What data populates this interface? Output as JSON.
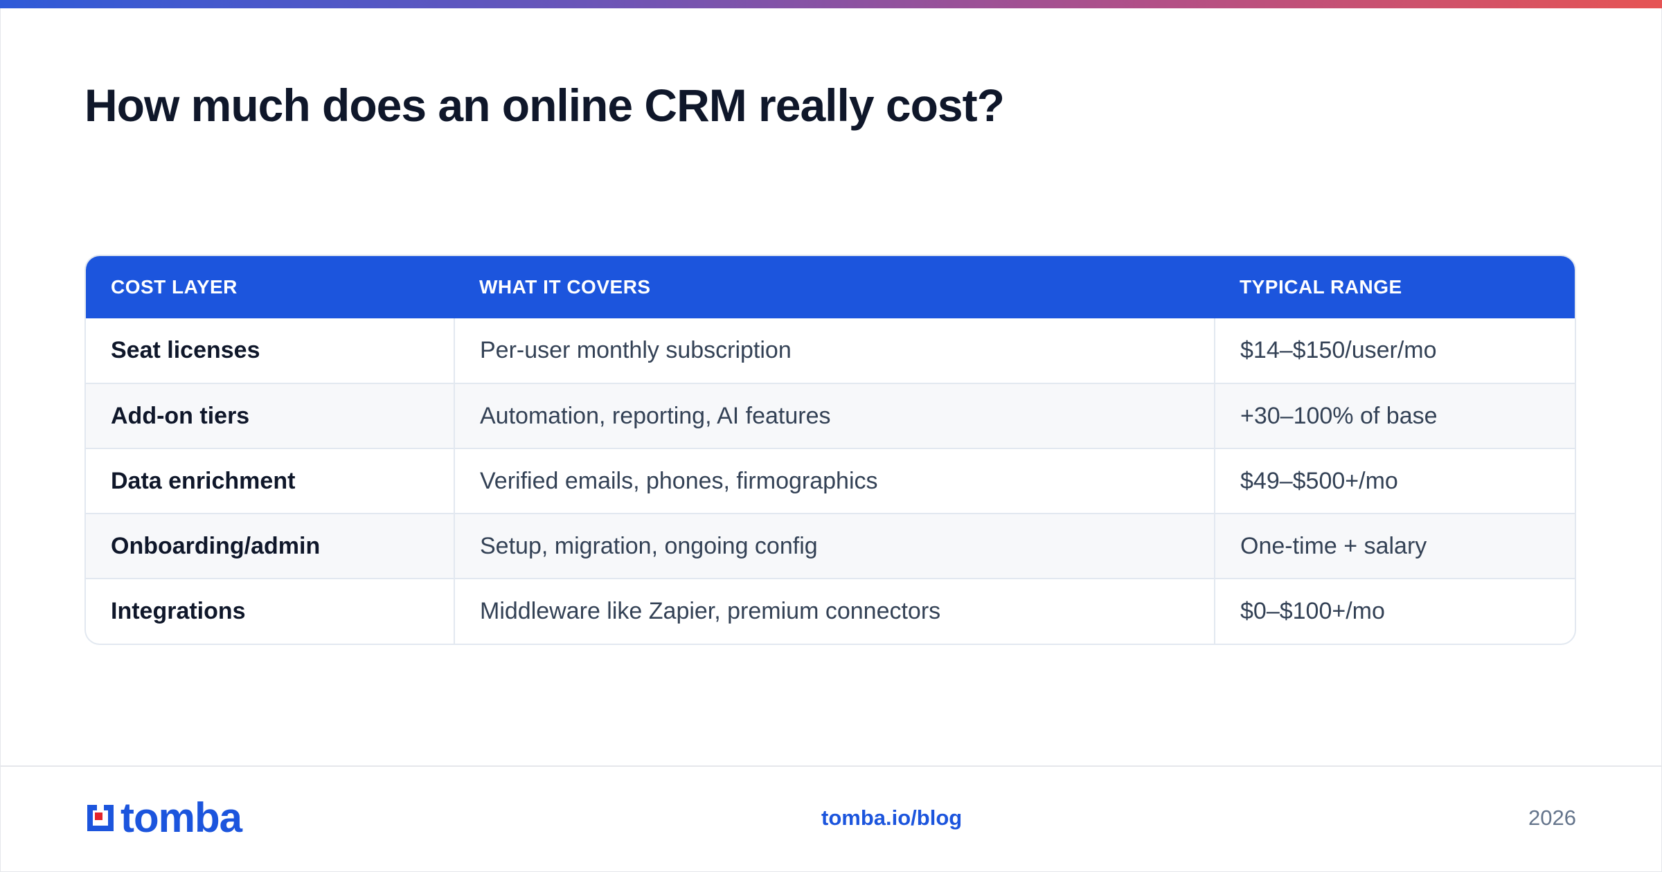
{
  "title": "How much does an online CRM really cost?",
  "table": {
    "headers": [
      "COST LAYER",
      "WHAT IT COVERS",
      "TYPICAL RANGE"
    ],
    "rows": [
      [
        "Seat licenses",
        "Per-user monthly subscription",
        "$14–$150/user/mo"
      ],
      [
        "Add-on tiers",
        "Automation, reporting, AI features",
        "+30–100% of base"
      ],
      [
        "Data enrichment",
        "Verified emails, phones, firmographics",
        "$49–$500+/mo"
      ],
      [
        "Onboarding/admin",
        "Setup, migration, ongoing config",
        "One-time + salary"
      ],
      [
        "Integrations",
        "Middleware like Zapier, premium connectors",
        "$0–$100+/mo"
      ]
    ]
  },
  "footer": {
    "logo_text": "tomba",
    "logo_icon": "tomba-logo-icon",
    "link": "tomba.io/blog",
    "year": "2026"
  },
  "colors": {
    "accent": "#1c55dd",
    "logo_red": "#e3242b",
    "heading": "#0f172a"
  }
}
